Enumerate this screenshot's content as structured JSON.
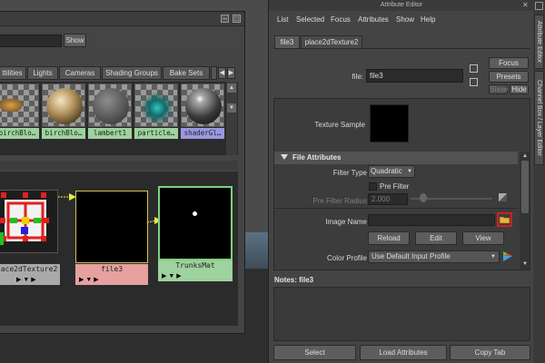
{
  "hypershade": {
    "show_button": "Show",
    "tabs": [
      "ttilities",
      "Lights",
      "Cameras",
      "Shading Groups",
      "Bake Sets"
    ],
    "tab_partial": "",
    "swatches": [
      {
        "label": "birchBlo…",
        "kind": "texture"
      },
      {
        "label": "birchBlo…",
        "kind": "texture-sphere"
      },
      {
        "label": "lambert1",
        "kind": "lambert"
      },
      {
        "label": "particle…",
        "kind": "particle"
      },
      {
        "label": "shaderGl…",
        "kind": "shader"
      }
    ],
    "nodes": {
      "place2d": {
        "label": "ace2dTexture2"
      },
      "file": {
        "label": "file3"
      },
      "material": {
        "label": "TrunksMat"
      }
    },
    "node_ports_glyph": "▶  ▼  ▶"
  },
  "attribute_editor": {
    "title": "Attribute Editor",
    "menu": [
      "List",
      "Selected",
      "Focus",
      "Attributes",
      "Show",
      "Help"
    ],
    "tabs": [
      "file3",
      "place2dTexture2"
    ],
    "file_label": "file:",
    "file_value": "file3",
    "buttons": {
      "focus": "Focus",
      "presets": "Presets",
      "show": "Show",
      "hide": "Hide"
    },
    "texture_sample_label": "Texture Sample",
    "section_title": "File Attributes",
    "filter_type_label": "Filter Type",
    "filter_type_value": "Quadratic",
    "pre_filter_label": "Pre Filter",
    "pre_filter_radius_label": "Pre Filter Radius",
    "pre_filter_radius_value": "2.000",
    "image_name_label": "Image Name",
    "image_name_value": "",
    "reload": "Reload",
    "edit": "Edit",
    "view": "View",
    "color_profile_label": "Color Profile",
    "color_profile_value": "Use Default Input Profile",
    "notes_label": "Notes:",
    "notes_object": "file3",
    "bottom_buttons": [
      "Select",
      "Load Attributes",
      "Copy Tab"
    ]
  },
  "side_tabs": [
    "Attribute Editor",
    "Channel Box / Layer Editor"
  ],
  "colors": {
    "swatch_label_green": "#9ed29e",
    "material_node_border": "#7fd17f",
    "file_node_border": "#d1c34a",
    "file_label_bg": "#e6a0a0",
    "highlight_red": "#d02020"
  }
}
